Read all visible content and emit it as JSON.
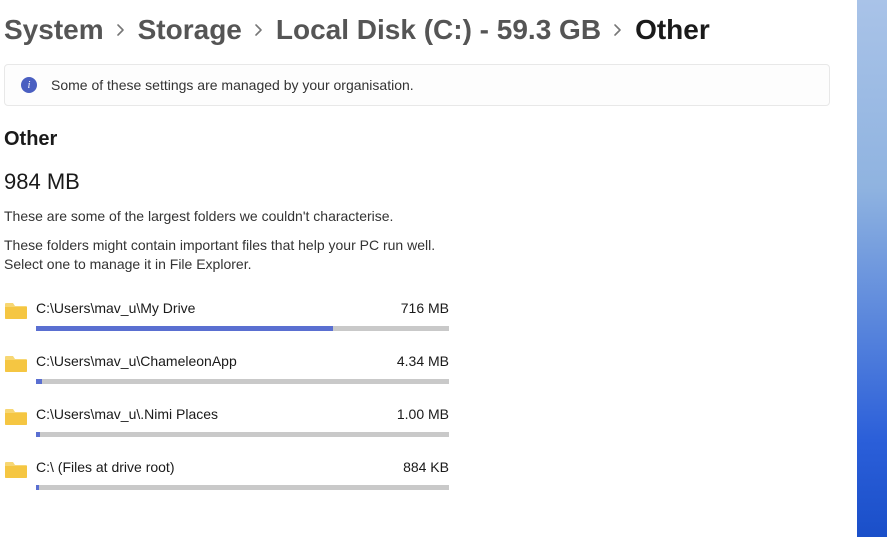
{
  "breadcrumb": {
    "items": [
      "System",
      "Storage",
      "Local Disk (C:) - 59.3 GB"
    ],
    "current": "Other"
  },
  "banner": {
    "text": "Some of these settings are managed by your organisation."
  },
  "section": {
    "title": "Other",
    "total": "984 MB",
    "desc1": "These are some of the largest folders we couldn't characterise.",
    "desc2": "These folders might contain important files that help your PC run well.",
    "desc3": "Select one to manage it in File Explorer."
  },
  "folders": [
    {
      "path": "C:\\Users\\mav_u\\My Drive",
      "size": "716 MB",
      "pct": 72
    },
    {
      "path": "C:\\Users\\mav_u\\ChameleonApp",
      "size": "4.34 MB",
      "pct": 1.5
    },
    {
      "path": "C:\\Users\\mav_u\\.Nimi Places",
      "size": "1.00 MB",
      "pct": 1
    },
    {
      "path": "C:\\ (Files at drive root)",
      "size": "884 KB",
      "pct": 0.8
    }
  ]
}
